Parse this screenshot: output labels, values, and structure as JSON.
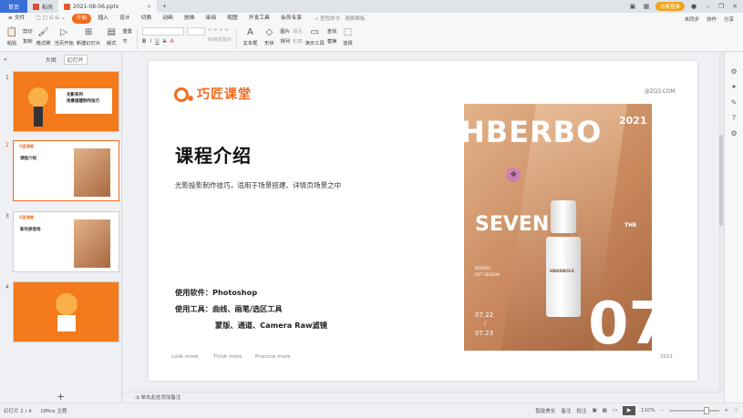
{
  "tabs": {
    "home": "首页",
    "docer": "稻壳",
    "file": "2021-08-06.pptx",
    "add": "+"
  },
  "top_right": {
    "login": "访客登录"
  },
  "menu": {
    "items": [
      "≡ 文件",
      "开始",
      "插入",
      "设计",
      "切换",
      "动画",
      "放映",
      "审阅",
      "视图",
      "开发工具",
      "会员专享"
    ],
    "active_index": 1,
    "search": "查找命令、搜索模板",
    "right": [
      "未同步",
      "协作",
      "分享"
    ]
  },
  "ribbon": {
    "paste": "粘贴",
    "cut": "剪切",
    "copy": "复制",
    "format_painter": "格式刷",
    "from_start": "当页开始",
    "new_slide": "新建幻灯片",
    "layout": "版式",
    "reset": "重置",
    "section": "节",
    "convert_smart": "转换成图示",
    "text_box": "文本框",
    "shape": "形状",
    "arrange": "排列",
    "picture": "图片",
    "fill": "填充",
    "outline": "轮廓",
    "present_tools": "演示工具",
    "find": "查找",
    "replace": "替换",
    "select": "选择"
  },
  "left_pane": {
    "outline": "大纲",
    "slides": "幻灯片",
    "numbers": [
      "1",
      "2",
      "3",
      "4"
    ],
    "add": "+"
  },
  "thumbs": {
    "t1_title1": "光影系列",
    "t1_title2": "场景搭建制作技巧",
    "t2_title": "课程介绍",
    "t3_title": "新的表现场"
  },
  "slide": {
    "logo_text": "巧匠课堂",
    "site": "@ZQ3.COM",
    "title": "课程介绍",
    "subtitle": "光影投影制作技巧，适用于场景搭建、详情页场景之中",
    "software": "使用软件：Photoshop",
    "tools1": "使用工具：曲线、画笔/选区工具",
    "tools2": "蒙版、通道、Camera Raw滤镜",
    "footer": [
      "Look more",
      "Think more",
      "Practice more"
    ],
    "year": "2021"
  },
  "poster": {
    "brand": "HBERBO",
    "year": "2021",
    "seven": "SEVEN",
    "the": "THE",
    "bottle": "HBERBOLE",
    "date1": "07.22",
    "date_sep": "/",
    "date2": "07.23",
    "big": "07",
    "small1": "BEVERLY",
    "small2": "GIFT SEASON"
  },
  "notes": "单击此处添加备注",
  "status": {
    "slide_pos": "幻灯片 2 / 4",
    "theme": "Office 主题",
    "smart": "智能美化",
    "notes": "备注",
    "comments": "批注",
    "zoom": "110%"
  },
  "colors": {
    "accent": "#f26b1d",
    "tab_blue": "#3a6fd8"
  }
}
